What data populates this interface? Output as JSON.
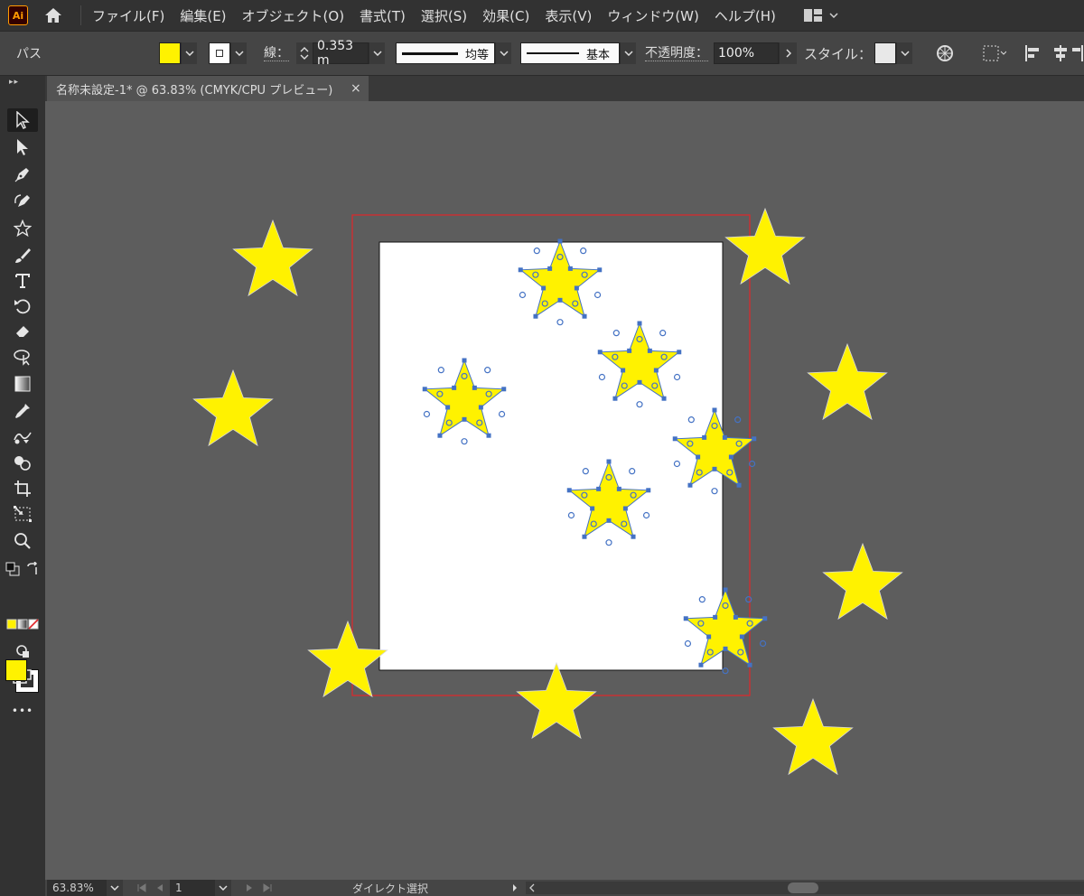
{
  "app": {
    "logo_text": "Ai",
    "accent_color": "#ff9a00"
  },
  "menu": {
    "items": [
      {
        "label": "ファイル(F)"
      },
      {
        "label": "編集(E)"
      },
      {
        "label": "オブジェクト(O)"
      },
      {
        "label": "書式(T)"
      },
      {
        "label": "選択(S)"
      },
      {
        "label": "効果(C)"
      },
      {
        "label": "表示(V)"
      },
      {
        "label": "ウィンドウ(W)"
      },
      {
        "label": "ヘルプ(H)"
      }
    ]
  },
  "control_bar": {
    "selection_label": "パス",
    "fill_color": "#fff200",
    "stroke_color": "#ffffff",
    "stroke_label": "線：",
    "stroke_weight": "0.353 m",
    "variable_width_label": "均等",
    "brush_label": "基本",
    "opacity_label": "不透明度：",
    "opacity_value": "100%",
    "style_label": "スタイル："
  },
  "document_tab": {
    "title": "名称未設定-1* @ 63.83% (CMYK/CPU プレビュー)",
    "close_glyph": "×"
  },
  "toolbar": {
    "tools": [
      {
        "name": "selection-tool",
        "icon": "arrow-icon",
        "active": true
      },
      {
        "name": "direct-selection-tool",
        "icon": "direct-arrow-icon"
      },
      {
        "name": "pen-tool",
        "icon": "pen-icon"
      },
      {
        "name": "curvature-tool",
        "icon": "curvature-icon"
      },
      {
        "name": "star-tool",
        "icon": "star-icon"
      },
      {
        "name": "paintbrush-tool",
        "icon": "brush-icon"
      },
      {
        "name": "type-tool",
        "icon": "type-icon"
      },
      {
        "name": "rotate-tool",
        "icon": "rotate-icon"
      },
      {
        "name": "eraser-tool",
        "icon": "eraser-icon"
      },
      {
        "name": "lasso-tool",
        "icon": "lasso-icon"
      },
      {
        "name": "gradient-tool",
        "icon": "gradient-icon"
      },
      {
        "name": "eyedropper-tool",
        "icon": "eyedropper-icon"
      },
      {
        "name": "blend-tool",
        "icon": "blend-icon"
      },
      {
        "name": "shape-builder-tool",
        "icon": "shape-builder-icon"
      },
      {
        "name": "artboard-tool",
        "icon": "artboard-icon"
      },
      {
        "name": "free-transform-tool",
        "icon": "free-transform-icon"
      },
      {
        "name": "zoom-tool",
        "icon": "magnifier-icon"
      }
    ],
    "fill_color": "#fff200",
    "more_glyph": "•••"
  },
  "canvas": {
    "artboard_color": "#ffffff",
    "bleed_color": "#e0262a",
    "star_color": "#fff200",
    "anchor_color": "#4472c4"
  },
  "status_bar": {
    "zoom": "63.83%",
    "page": "1",
    "tool_name": "ダイレクト選択"
  }
}
